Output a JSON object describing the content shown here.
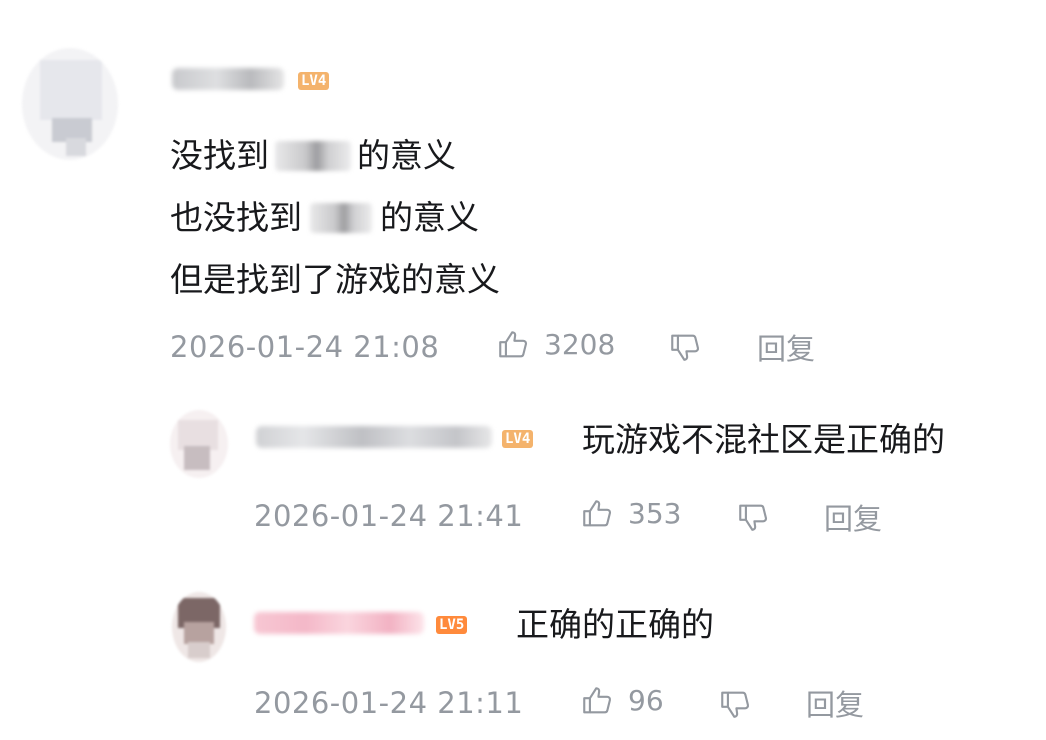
{
  "comments": [
    {
      "level": "LV4",
      "lines": [
        {
          "before": "没找到",
          "after": "的意义"
        },
        {
          "before": "也没找到",
          "after": "的意义"
        },
        {
          "before": "但是找到了游戏的意义",
          "after": ""
        }
      ],
      "time": "2026-01-24 21:08",
      "likes": "3208",
      "reply_label": "回复"
    },
    {
      "level": "LV4",
      "text": "玩游戏不混社区是正确的",
      "time": "2026-01-24 21:41",
      "likes": "353",
      "reply_label": "回复"
    },
    {
      "level": "LV5",
      "text": "正确的正确的",
      "time": "2026-01-24 21:11",
      "likes": "96",
      "reply_label": "回复"
    }
  ],
  "icons": {
    "like": "thumbs-up-icon",
    "dislike": "thumbs-down-icon"
  },
  "colors": {
    "meta_gray": "#9499a0",
    "text": "#18191c",
    "lv4": "#f4b36c",
    "lv5": "#ff8a3c"
  }
}
